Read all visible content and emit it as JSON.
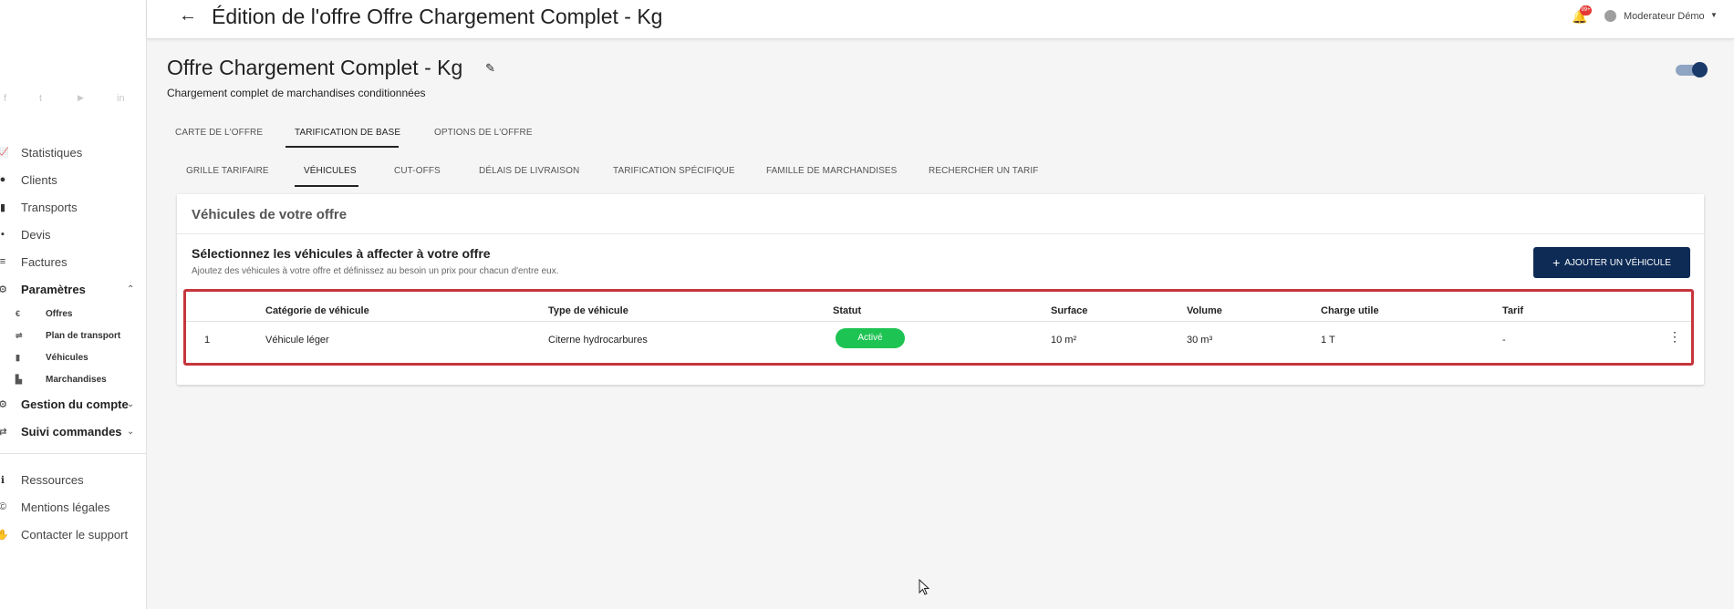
{
  "header": {
    "title": "Édition de l'offre Offre Chargement Complet - Kg",
    "notif_count": "99+",
    "user_name": "Moderateur Démo"
  },
  "sidebar": {
    "social": [
      "f",
      "t",
      "▶",
      "in"
    ],
    "items": [
      {
        "label": "Statistiques",
        "icon": "chart-icon"
      },
      {
        "label": "Clients",
        "icon": "person-icon"
      },
      {
        "label": "Transports",
        "icon": "truck-icon"
      },
      {
        "label": "Devis",
        "icon": "document-icon"
      },
      {
        "label": "Factures",
        "icon": "list-icon"
      },
      {
        "label": "Paramètres",
        "icon": "gears-icon"
      }
    ],
    "sub_items": [
      {
        "label": "Offres",
        "icon": "euro-icon"
      },
      {
        "label": "Plan de transport",
        "icon": "signpost-icon"
      },
      {
        "label": "Véhicules",
        "icon": "truck-icon"
      },
      {
        "label": "Marchandises",
        "icon": "dolly-icon"
      }
    ],
    "items2": [
      {
        "label": "Gestion du compte",
        "icon": "user-cog-icon"
      },
      {
        "label": "Suivi commandes",
        "icon": "exchange-icon"
      }
    ],
    "items3": [
      {
        "label": "Ressources",
        "icon": "info-icon"
      },
      {
        "label": "Mentions légales",
        "icon": "copyright-icon"
      },
      {
        "label": "Contacter le support",
        "icon": "handshake-icon"
      }
    ]
  },
  "offer": {
    "title": "Offre Chargement Complet - Kg",
    "subtitle": "Chargement complet de marchandises conditionnées"
  },
  "tabs": [
    "CARTE DE L'OFFRE",
    "TARIFICATION DE BASE",
    "OPTIONS DE L'OFFRE"
  ],
  "subtabs": [
    "GRILLE TARIFAIRE",
    "VÉHICULES",
    "CUT-OFFS",
    "DÉLAIS DE LIVRAISON",
    "TARIFICATION SPÉCIFIQUE",
    "FAMILLE DE MARCHANDISES",
    "RECHERCHER UN TARIF"
  ],
  "card": {
    "title": "Véhicules de votre offre",
    "section_title": "Sélectionnez les véhicules à affecter à votre offre",
    "section_desc": "Ajoutez des véhicules à votre offre et définissez au besoin un prix pour chacun d'entre eux.",
    "add_button": "AJOUTER UN VÉHICULE"
  },
  "table": {
    "columns": [
      "Catégorie de véhicule",
      "Type de véhicule",
      "Statut",
      "Surface",
      "Volume",
      "Charge utile",
      "Tarif"
    ],
    "rows": [
      {
        "index": "1",
        "category": "Véhicule léger",
        "type": "Citerne hydrocarbures",
        "status": "Activé",
        "surface": "10 m²",
        "volume": "30 m³",
        "payload": "1 T",
        "tarif": "-"
      }
    ]
  },
  "colors": {
    "primary": "#0d2b55",
    "status_active": "#1ec453",
    "highlight": "#c6363c"
  }
}
